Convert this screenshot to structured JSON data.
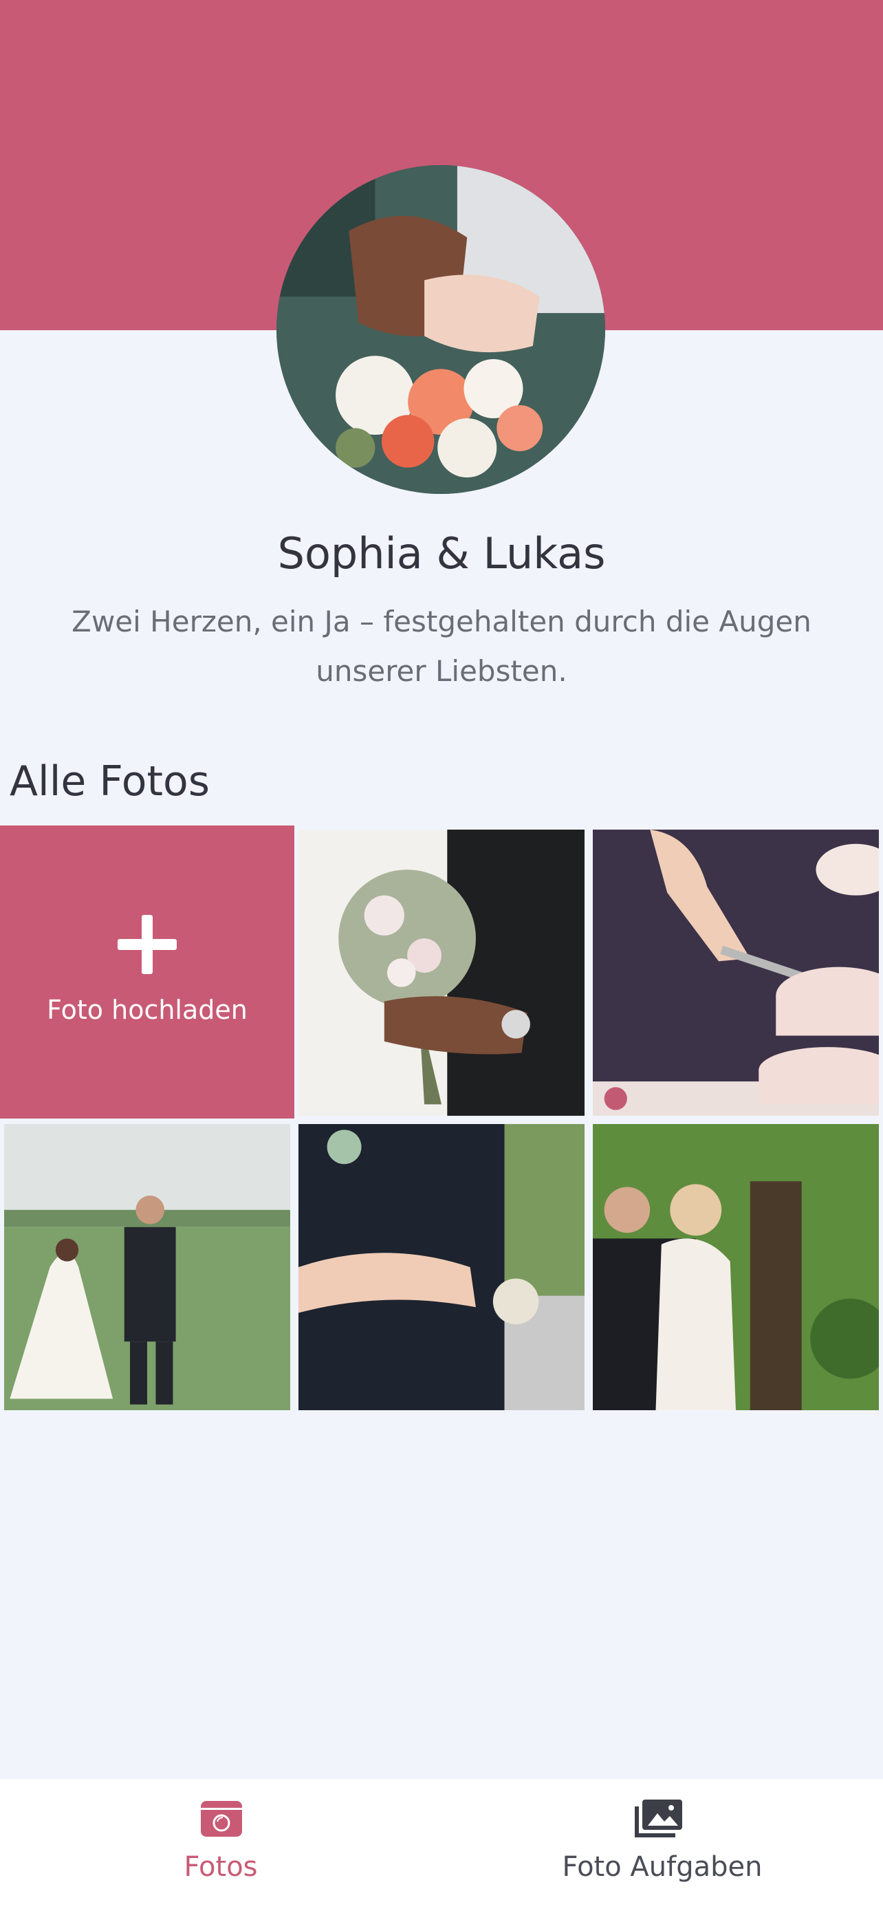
{
  "profile": {
    "names": "Sophia & Lukas",
    "tagline": "Zwei Herzen, ein Ja – festgehalten durch die Augen unserer Liebsten.",
    "avatar_icon": "wedding-rings-bouquet-photo"
  },
  "gallery": {
    "title": "Alle Fotos",
    "upload_label": "Foto hochladen",
    "photos": [
      "bouquet-in-hands-photo",
      "cake-cutting-photo",
      "couple-walking-field-photo",
      "couple-embrace-photo",
      "couple-under-tree-photo"
    ]
  },
  "nav": {
    "items": [
      {
        "label": "Fotos",
        "icon": "camera-icon",
        "active": true
      },
      {
        "label": "Foto Aufgaben",
        "icon": "photo-stack-icon",
        "active": false
      }
    ]
  },
  "colors": {
    "accent": "#c95a76",
    "background": "#f1f4fa",
    "text_dark": "#33343f",
    "text_muted": "#6a6c76"
  }
}
